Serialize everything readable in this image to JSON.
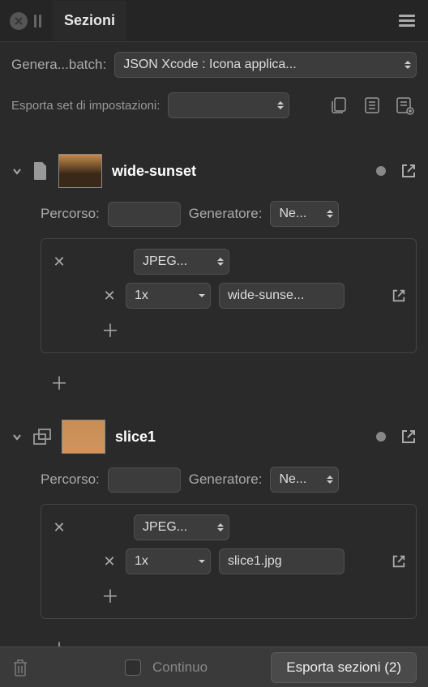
{
  "header": {
    "tab_title": "Sezioni"
  },
  "batch": {
    "label": "Genera...batch:",
    "value": "JSON Xcode : Icona applica..."
  },
  "settings": {
    "label": "Esporta set di impostazioni:",
    "value": ""
  },
  "sections": [
    {
      "title": "wide-sunset",
      "path_label": "Percorso:",
      "path_value": "",
      "generator_label": "Generatore:",
      "generator_value": "Ne...",
      "exports": [
        {
          "format": "JPEG...",
          "scale": "1x",
          "filename": "wide-sunse..."
        }
      ]
    },
    {
      "title": "slice1",
      "path_label": "Percorso:",
      "path_value": "",
      "generator_label": "Generatore:",
      "generator_value": "Ne...",
      "exports": [
        {
          "format": "JPEG...",
          "scale": "1x",
          "filename": "slice1.jpg"
        }
      ]
    }
  ],
  "footer": {
    "continuous_label": "Continuo",
    "export_label": "Esporta sezioni (2)"
  }
}
